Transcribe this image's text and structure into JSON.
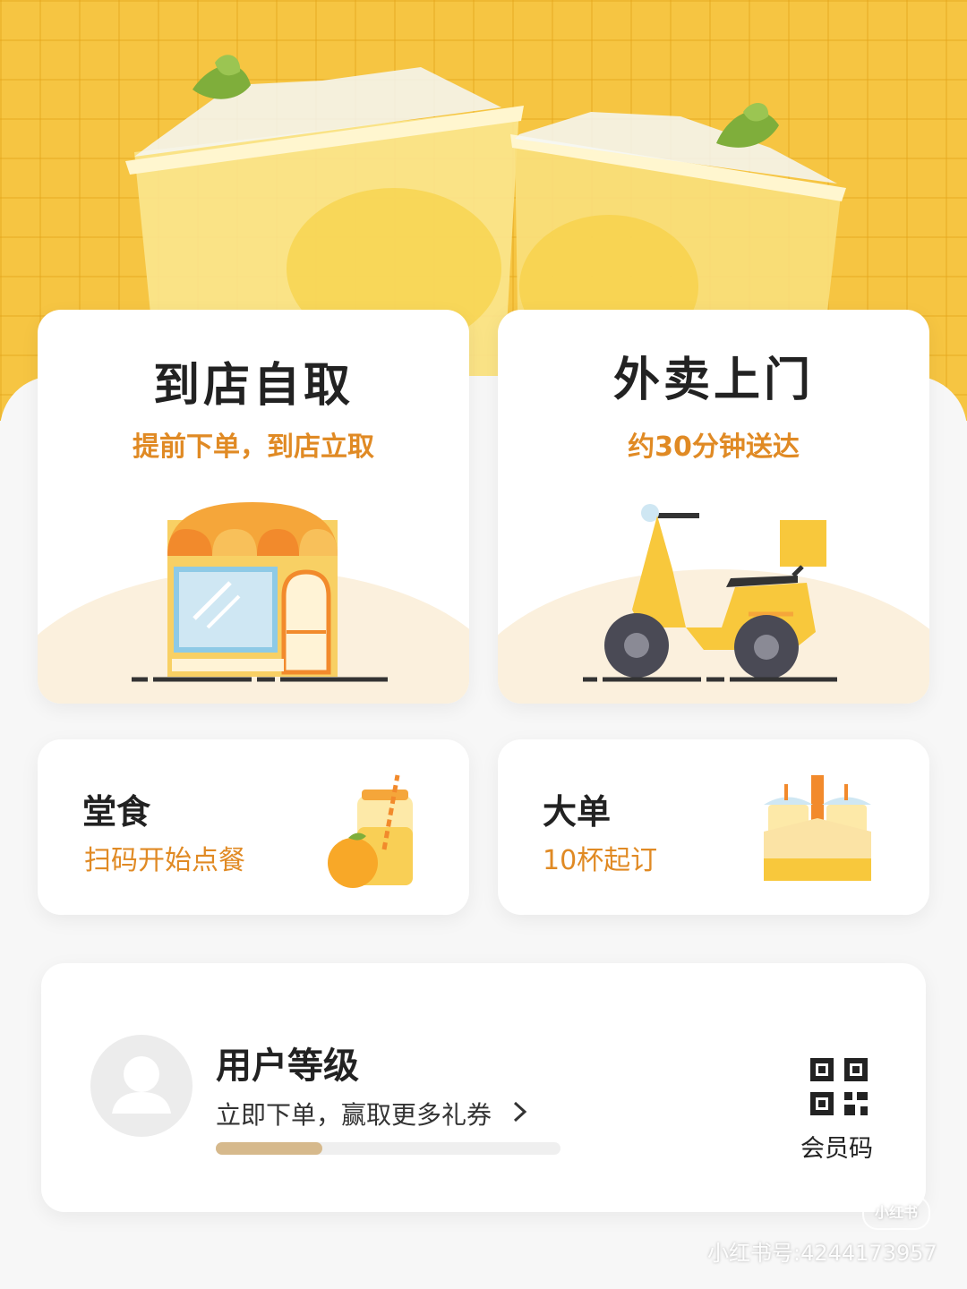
{
  "banner": {
    "image": "lemon-tea-cups-banner"
  },
  "order_modes": {
    "pickup": {
      "title": "到店自取",
      "subtitle": "提前下单，到店立取",
      "icon": "storefront-icon"
    },
    "delivery": {
      "title": "外卖上门",
      "subtitle": "约30分钟送达",
      "icon": "scooter-icon"
    },
    "dine_in": {
      "title": "堂食",
      "subtitle": "扫码开始点餐",
      "icon": "juice-jar-icon"
    },
    "bulk": {
      "title": "大单",
      "subtitle": "10杯起订",
      "icon": "drink-carrier-icon"
    }
  },
  "member": {
    "title": "用户等级",
    "subtitle": "立即下单，赢取更多礼券",
    "progress_fraction": 0.31,
    "qr_label": "会员码"
  },
  "watermark": {
    "badge": "小红书",
    "id_text": "小红书号:4244173957"
  },
  "colors": {
    "accent": "#e08a24",
    "banner_yellow": "#f6c542",
    "progress": "#d6b98c"
  }
}
